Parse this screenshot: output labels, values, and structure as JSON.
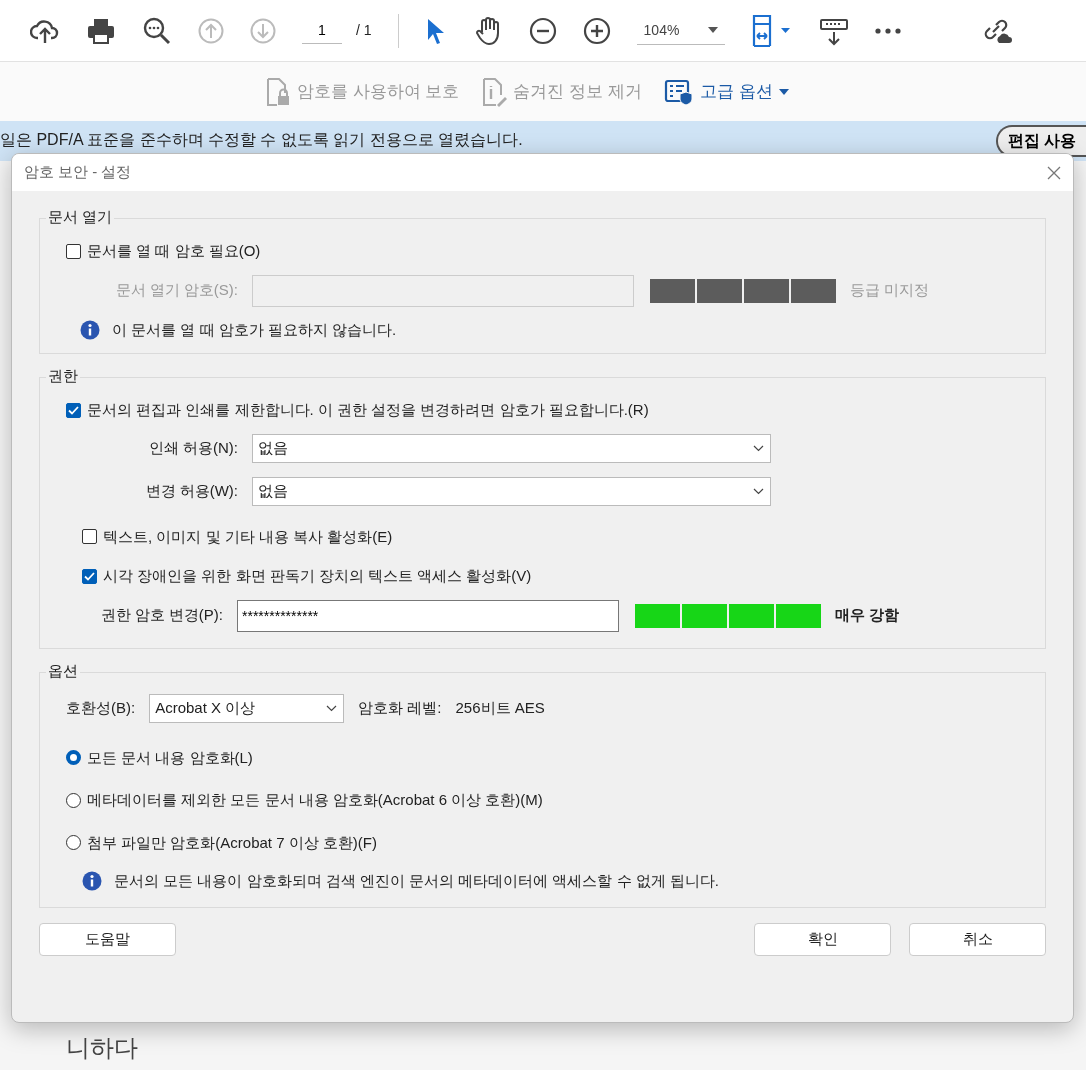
{
  "toolbar": {
    "nav_buttons": [
      {
        "disabled": true
      },
      {
        "disabled": true
      }
    ],
    "page_number": "1",
    "page_total": "/ 1",
    "tools": [
      {
        "selected": true
      },
      {
        "selected": false
      }
    ],
    "zoom": "104%"
  },
  "protect_toolbar": [
    {
      "kind": "lock",
      "label": "암호를 사용하여 보호",
      "disabled": true
    },
    {
      "kind": "info",
      "label": "숨겨진 정보 제거",
      "disabled": true
    },
    {
      "kind": "options",
      "label": "고급 옵션",
      "disabled": false
    }
  ],
  "info_bar": {
    "message": "일은 PDF/A 표준을 준수하며 수정할 수 없도록 읽기 전용으로 열렸습니다.",
    "button": "편집 사용"
  },
  "document_text": "니하다",
  "dialog": {
    "title": "암호 보안 - 설정",
    "open_section": {
      "legend": "문서 열기",
      "require": {
        "label": "문서를 열 때 암호 필요(O)",
        "checked": false
      },
      "password": {
        "label": "문서 열기 암호(S):",
        "disabled": true,
        "level": 0,
        "rating": "등급 미지정"
      },
      "info": "이 문서를 열 때 암호가 필요하지 않습니다."
    },
    "permissions": {
      "legend": "권한",
      "restrict": {
        "label": "문서의 편집과 인쇄를 제한합니다. 이 권한 설정을 변경하려면 암호가 필요합니다.(R)",
        "checked": true
      },
      "selects": [
        {
          "label": "인쇄 허용(N):",
          "value": "없음"
        },
        {
          "label": "변경 허용(W):",
          "value": "없음"
        }
      ],
      "options": [
        {
          "label": "텍스트, 이미지 및 기타 내용 복사 활성화(E)",
          "checked": false
        },
        {
          "label": "시각 장애인을 위한 화면 판독기 장치의 텍스트 액세스 활성화(V)",
          "checked": true
        }
      ],
      "password": {
        "label": "권한 암호 변경(P):",
        "value": "**************",
        "disabled": false,
        "level": 1,
        "rating": "매우 강함"
      }
    },
    "options": {
      "legend": "옵션",
      "compat_label": "호환성(B):",
      "compat_value": "Acrobat X 이상",
      "enc_label": "암호화 레벨:",
      "enc_value": "256비트 AES",
      "radios": [
        {
          "label": "모든 문서 내용 암호화(L)",
          "selected": true
        },
        {
          "label": "메타데이터를 제외한 모든 문서 내용 암호화(Acrobat 6 이상 호환)(M)",
          "selected": false
        },
        {
          "label": "첨부 파일만 암호화(Acrobat 7 이상 호환)(F)",
          "selected": false
        }
      ],
      "info": "문서의 모든 내용이 암호화되며 검색 엔진이 문서의 메타데이터에 액세스할 수 없게 됩니다."
    },
    "help_button": "도움말",
    "buttons": [
      "확인",
      "취소"
    ]
  }
}
